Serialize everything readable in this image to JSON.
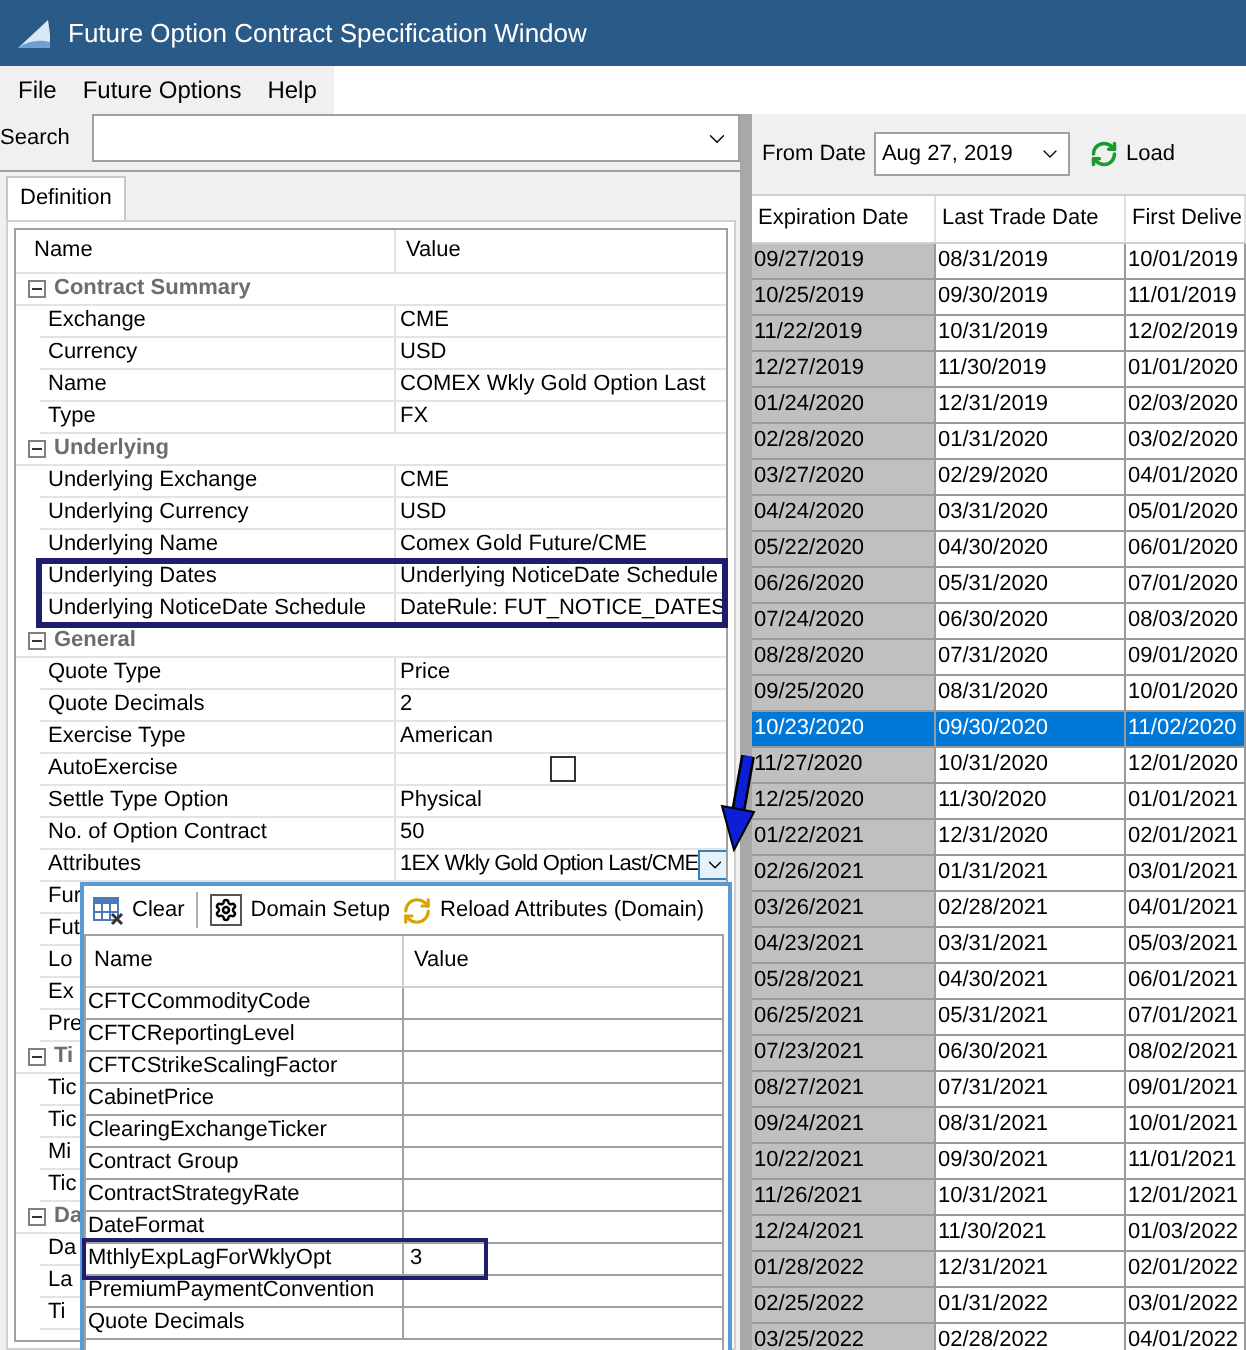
{
  "window": {
    "title": "Future Option Contract Specification Window"
  },
  "menu": [
    {
      "label": "File"
    },
    {
      "label": "Future Options"
    },
    {
      "label": "Help"
    }
  ],
  "search": {
    "label": "Search"
  },
  "tabs": [
    {
      "label": "Definition",
      "selected": true
    }
  ],
  "property_grid": {
    "columns": [
      "Name",
      "Value"
    ],
    "groups": [
      {
        "name": "Contract Summary",
        "expanded": true,
        "rows": [
          {
            "kind": "text",
            "name": "Exchange",
            "value": "CME"
          },
          {
            "kind": "text",
            "name": "Currency",
            "value": "USD"
          },
          {
            "kind": "text",
            "name": "Name",
            "value": "COMEX Wkly Gold Option Last"
          },
          {
            "kind": "text",
            "name": "Type",
            "value": "FX"
          }
        ]
      },
      {
        "name": "Underlying",
        "expanded": true,
        "rows": [
          {
            "kind": "text",
            "name": "Underlying Exchange",
            "value": "CME"
          },
          {
            "kind": "text",
            "name": "Underlying Currency",
            "value": "USD"
          },
          {
            "kind": "text",
            "name": "Underlying Name",
            "value": "Comex Gold Future/CME"
          },
          {
            "kind": "text",
            "name": "Underlying Dates",
            "value": "Underlying NoticeDate Schedule"
          },
          {
            "kind": "text",
            "name": "Underlying NoticeDate Schedule",
            "value": "DateRule: FUT_NOTICE_DATES"
          }
        ]
      },
      {
        "name": "General",
        "expanded": true,
        "rows": [
          {
            "kind": "text",
            "name": "Quote Type",
            "value": "Price"
          },
          {
            "kind": "text",
            "name": "Quote Decimals",
            "value": "2"
          },
          {
            "kind": "text",
            "name": "Exercise Type",
            "value": "American"
          },
          {
            "kind": "checkbox",
            "name": "AutoExercise",
            "checked": false
          },
          {
            "kind": "text",
            "name": "Settle Type Option",
            "value": "Physical"
          },
          {
            "kind": "text",
            "name": "No. of Option Contract",
            "value": "50"
          },
          {
            "kind": "dropdown",
            "name": "Attributes",
            "value": "1EX Wkly Gold Option Last/CME"
          },
          {
            "kind": "text",
            "name": "Fur"
          },
          {
            "kind": "text",
            "name": "Fut"
          },
          {
            "kind": "text",
            "name": "Lo"
          },
          {
            "kind": "text",
            "name": "Ex"
          },
          {
            "kind": "text",
            "name": "Pre"
          }
        ]
      },
      {
        "name": "Ti",
        "expanded": true,
        "rows": [
          {
            "kind": "text",
            "name": "Tic"
          },
          {
            "kind": "text",
            "name": "Tic"
          },
          {
            "kind": "text",
            "name": "Mi"
          },
          {
            "kind": "text",
            "name": "Tic"
          }
        ]
      },
      {
        "name": "Da",
        "expanded": true,
        "rows": [
          {
            "kind": "text",
            "name": "Da"
          },
          {
            "kind": "text",
            "name": "La"
          },
          {
            "kind": "text",
            "name": "Ti"
          }
        ]
      }
    ]
  },
  "attributes_popup": {
    "toolbar": [
      {
        "kind": "clear",
        "label": "Clear"
      },
      {
        "kind": "gear",
        "label": "Domain Setup"
      },
      {
        "kind": "reload",
        "label": "Reload Attributes (Domain)"
      }
    ],
    "columns": [
      "Name",
      "Value"
    ],
    "rows": [
      {
        "name": "CFTCCommodityCode"
      },
      {
        "name": "CFTCReportingLevel"
      },
      {
        "name": "CFTCStrikeScalingFactor"
      },
      {
        "name": "CabinetPrice"
      },
      {
        "name": "ClearingExchangeTicker"
      },
      {
        "name": "Contract Group"
      },
      {
        "name": "ContractStrategyRate"
      },
      {
        "name": "DateFormat"
      },
      {
        "name": "MthlyExpLagForWklyOpt",
        "value": "3"
      },
      {
        "name": "PremiumPaymentConvention"
      },
      {
        "name": "Quote Decimals"
      }
    ]
  },
  "from_date": {
    "label": "From Date",
    "value": "Aug 27, 2019"
  },
  "load_button": {
    "label": "Load"
  },
  "expirations": {
    "columns": [
      "Expiration Date",
      "Last Trade Date",
      "First Delive"
    ],
    "rows": [
      {
        "cells": [
          "09/27/2019",
          "08/31/2019",
          "10/01/2019"
        ],
        "selected": false
      },
      {
        "cells": [
          "10/25/2019",
          "09/30/2019",
          "11/01/2019"
        ],
        "selected": false
      },
      {
        "cells": [
          "11/22/2019",
          "10/31/2019",
          "12/02/2019"
        ],
        "selected": false
      },
      {
        "cells": [
          "12/27/2019",
          "11/30/2019",
          "01/01/2020"
        ],
        "selected": false
      },
      {
        "cells": [
          "01/24/2020",
          "12/31/2019",
          "02/03/2020"
        ],
        "selected": false
      },
      {
        "cells": [
          "02/28/2020",
          "01/31/2020",
          "03/02/2020"
        ],
        "selected": false
      },
      {
        "cells": [
          "03/27/2020",
          "02/29/2020",
          "04/01/2020"
        ],
        "selected": false
      },
      {
        "cells": [
          "04/24/2020",
          "03/31/2020",
          "05/01/2020"
        ],
        "selected": false
      },
      {
        "cells": [
          "05/22/2020",
          "04/30/2020",
          "06/01/2020"
        ],
        "selected": false
      },
      {
        "cells": [
          "06/26/2020",
          "05/31/2020",
          "07/01/2020"
        ],
        "selected": false
      },
      {
        "cells": [
          "07/24/2020",
          "06/30/2020",
          "08/03/2020"
        ],
        "selected": false
      },
      {
        "cells": [
          "08/28/2020",
          "07/31/2020",
          "09/01/2020"
        ],
        "selected": false
      },
      {
        "cells": [
          "09/25/2020",
          "08/31/2020",
          "10/01/2020"
        ],
        "selected": false
      },
      {
        "cells": [
          "10/23/2020",
          "09/30/2020",
          "11/02/2020"
        ],
        "selected": true
      },
      {
        "cells": [
          "11/27/2020",
          "10/31/2020",
          "12/01/2020"
        ],
        "selected": false
      },
      {
        "cells": [
          "12/25/2020",
          "11/30/2020",
          "01/01/2021"
        ],
        "selected": false
      },
      {
        "cells": [
          "01/22/2021",
          "12/31/2020",
          "02/01/2021"
        ],
        "selected": false
      },
      {
        "cells": [
          "02/26/2021",
          "01/31/2021",
          "03/01/2021"
        ],
        "selected": false
      },
      {
        "cells": [
          "03/26/2021",
          "02/28/2021",
          "04/01/2021"
        ],
        "selected": false
      },
      {
        "cells": [
          "04/23/2021",
          "03/31/2021",
          "05/03/2021"
        ],
        "selected": false
      },
      {
        "cells": [
          "05/28/2021",
          "04/30/2021",
          "06/01/2021"
        ],
        "selected": false
      },
      {
        "cells": [
          "06/25/2021",
          "05/31/2021",
          "07/01/2021"
        ],
        "selected": false
      },
      {
        "cells": [
          "07/23/2021",
          "06/30/2021",
          "08/02/2021"
        ],
        "selected": false
      },
      {
        "cells": [
          "08/27/2021",
          "07/31/2021",
          "09/01/2021"
        ],
        "selected": false
      },
      {
        "cells": [
          "09/24/2021",
          "08/31/2021",
          "10/01/2021"
        ],
        "selected": false
      },
      {
        "cells": [
          "10/22/2021",
          "09/30/2021",
          "11/01/2021"
        ],
        "selected": false
      },
      {
        "cells": [
          "11/26/2021",
          "10/31/2021",
          "12/01/2021"
        ],
        "selected": false
      },
      {
        "cells": [
          "12/24/2021",
          "11/30/2021",
          "01/03/2022"
        ],
        "selected": false
      },
      {
        "cells": [
          "01/28/2022",
          "12/31/2021",
          "02/01/2022"
        ],
        "selected": false
      },
      {
        "cells": [
          "02/25/2022",
          "01/31/2022",
          "03/01/2022"
        ],
        "selected": false
      },
      {
        "cells": [
          "03/25/2022",
          "02/28/2022",
          "04/01/2022"
        ],
        "selected": false
      }
    ]
  }
}
